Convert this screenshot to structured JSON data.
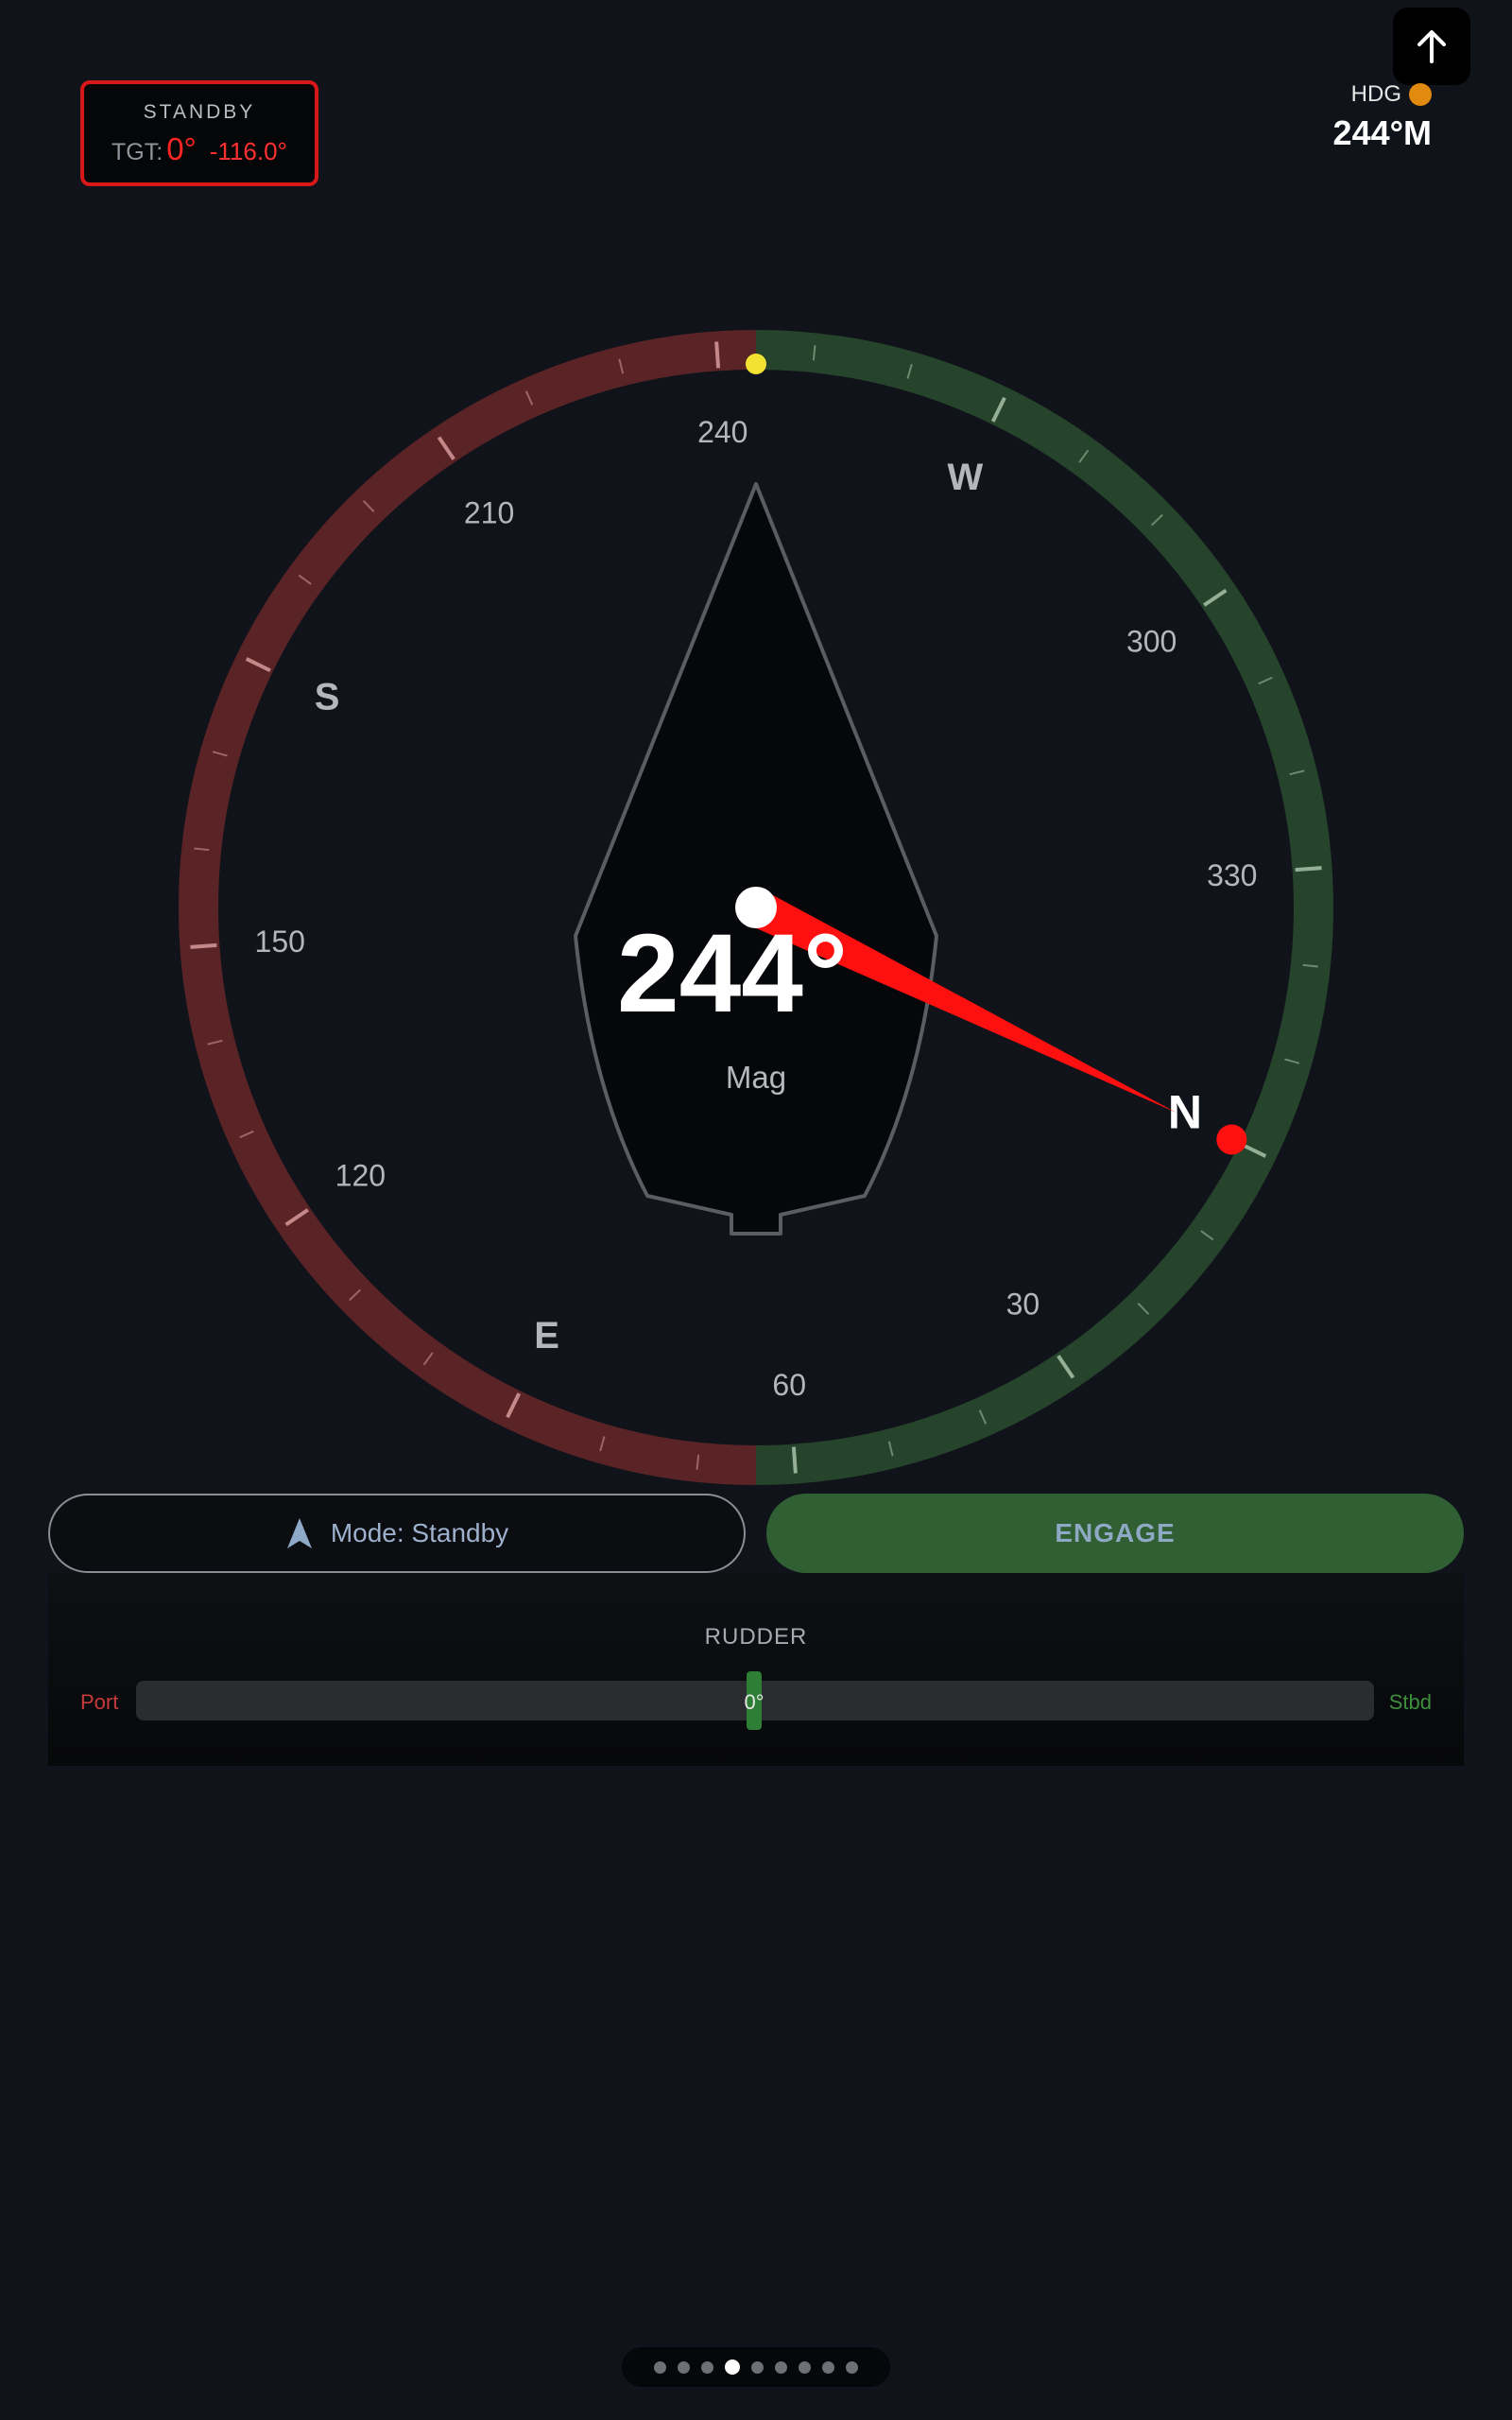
{
  "standby": {
    "title": "STANDBY",
    "tgt_label": "TGT:",
    "tgt_value": "0°",
    "tgt_offset": "-116.0°"
  },
  "hdg": {
    "label": "HDG",
    "value": "244°M",
    "status_color": "#e08a10"
  },
  "compass": {
    "heading_deg": 244,
    "heading_display": "244°",
    "reference": "Mag",
    "target_deg": 0,
    "tick_labels": [
      {
        "deg": 240,
        "text": "240"
      },
      {
        "deg": 210,
        "text": "210"
      },
      {
        "deg": 180,
        "text": "S"
      },
      {
        "deg": 150,
        "text": "150"
      },
      {
        "deg": 120,
        "text": "120"
      },
      {
        "deg": 90,
        "text": "E"
      },
      {
        "deg": 60,
        "text": "60"
      },
      {
        "deg": 30,
        "text": "30"
      },
      {
        "deg": 0,
        "text": "N"
      },
      {
        "deg": 330,
        "text": "330"
      },
      {
        "deg": 300,
        "text": "300"
      },
      {
        "deg": 270,
        "text": "W"
      }
    ],
    "port_color": "#5a2326",
    "starboard_color": "#26432b",
    "target_color": "#ff1010",
    "heading_marker_color": "#f2e232"
  },
  "mode_button": {
    "icon": "navigation-arrow-icon",
    "label": "Mode: Standby"
  },
  "engage_button": {
    "label": "ENGAGE"
  },
  "rudder": {
    "title": "RUDDER",
    "port_label": "Port",
    "stbd_label": "Stbd",
    "angle": "0°",
    "angle_deg": 0
  },
  "pager": {
    "count": 9,
    "active_index": 3
  },
  "top_right_button": {
    "icon": "arrow-up-icon"
  }
}
